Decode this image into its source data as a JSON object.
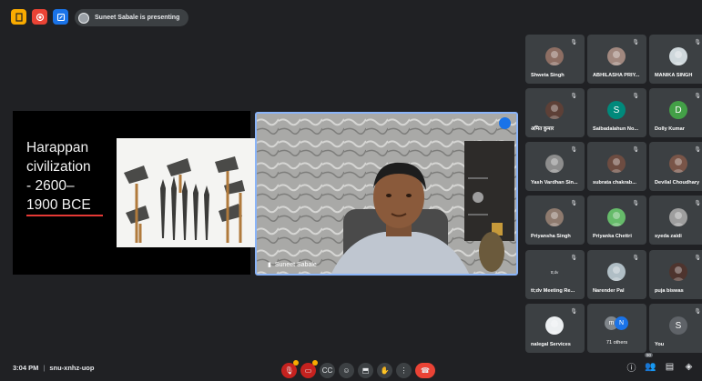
{
  "topbar": {
    "presenting_text": "Suneet Sabale is presenting"
  },
  "slide": {
    "title": "Harappan\ncivilization\n- 2600–\n1900 BCE",
    "accent_color": "#e53935"
  },
  "camera": {
    "name": "Suneet Sabale"
  },
  "participants": [
    {
      "name": "Shweta Singh",
      "avatar_color": "#8d6e63",
      "initial": ""
    },
    {
      "name": "ABHILASHA PRIY...",
      "avatar_color": "#a1887f",
      "initial": ""
    },
    {
      "name": "MANIKA SINGH",
      "avatar_color": "#cfd8dc",
      "initial": ""
    },
    {
      "name": "अमित कुमार",
      "avatar_color": "#5d4037",
      "initial": ""
    },
    {
      "name": "Saibadalahun No...",
      "avatar_color": "#00897b",
      "initial": "S"
    },
    {
      "name": "Dolly Kumar",
      "avatar_color": "#43a047",
      "initial": "D"
    },
    {
      "name": "Yash Vardhan Sin...",
      "avatar_color": "#8d8d8d",
      "initial": ""
    },
    {
      "name": "subrata chakrab...",
      "avatar_color": "#6d4c41",
      "initial": ""
    },
    {
      "name": "Devilal Choudhary",
      "avatar_color": "#795548",
      "initial": ""
    },
    {
      "name": "Priyansha Singh",
      "avatar_color": "#8e7a6e",
      "initial": ""
    },
    {
      "name": "Priyanka Chettri",
      "avatar_color": "#66bb6a",
      "initial": ""
    },
    {
      "name": "syeda zaidi",
      "avatar_color": "#9e9e9e",
      "initial": ""
    },
    {
      "name": "tt;dv Meeting Re...",
      "avatar_color": "#3c4043",
      "initial": "tt;dv"
    },
    {
      "name": "Narender Pal",
      "avatar_color": "#b0bec5",
      "initial": ""
    },
    {
      "name": "puja biswas",
      "avatar_color": "#4e342e",
      "initial": ""
    },
    {
      "name": "nalegal Services",
      "avatar_color": "#eceff1",
      "initial": ""
    },
    {
      "name": "71 others",
      "avatar_color": "#5f6368",
      "initial": ""
    },
    {
      "name": "You",
      "avatar_color": "#5f6368",
      "initial": "S"
    }
  ],
  "others_avatars": [
    {
      "initial": "m",
      "color": "#80868b"
    },
    {
      "initial": "N",
      "color": "#1a73e8"
    }
  ],
  "bottombar": {
    "time": "3:04 PM",
    "separator": "|",
    "meeting_code": "snu-xnhz-uop",
    "people_count": "90"
  }
}
